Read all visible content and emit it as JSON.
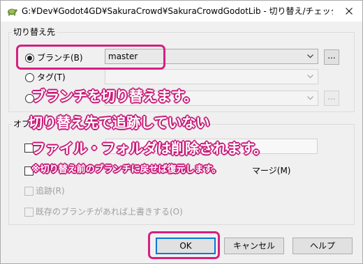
{
  "window": {
    "title": "G:¥Dev¥Godot4GD¥SakuraCrowd¥SakuraCrowdGodotLib - 切り替え/チェックアウト - Tort...",
    "app_icon": "tortoise-icon",
    "close_icon": "close-icon"
  },
  "switch_to": {
    "legend": "切り替え先",
    "branch": {
      "label": "ブランチ(B)",
      "selected": true,
      "value": "master"
    },
    "tag": {
      "label": "タグ(T)",
      "selected": false,
      "value": ""
    },
    "commit": {
      "label": "",
      "selected": false,
      "value": ""
    },
    "browse_label": "..."
  },
  "options": {
    "legend": "オプ",
    "items": [
      {
        "label": "",
        "checked": false,
        "enabled": true
      },
      {
        "label": "マージ(M)",
        "checked": false,
        "enabled": true
      },
      {
        "label": "追跡(R)",
        "checked": false,
        "enabled": false
      },
      {
        "label": "既存のブランチがあれば上書きする(O)",
        "checked": false,
        "enabled": false
      }
    ]
  },
  "buttons": {
    "ok": "OK",
    "cancel": "キャンセル",
    "help": "ヘルプ"
  },
  "annotations": {
    "line1": "ブランチを切り替えます。",
    "line2": "切り替え先で追跡していない",
    "line3": "ファイル・フォルダは削除されます。",
    "note": "※切り替え前のブランチに戻せば復元します。"
  },
  "accent_colors": {
    "highlight": "#d4207f",
    "default_button": "#0078d7"
  }
}
